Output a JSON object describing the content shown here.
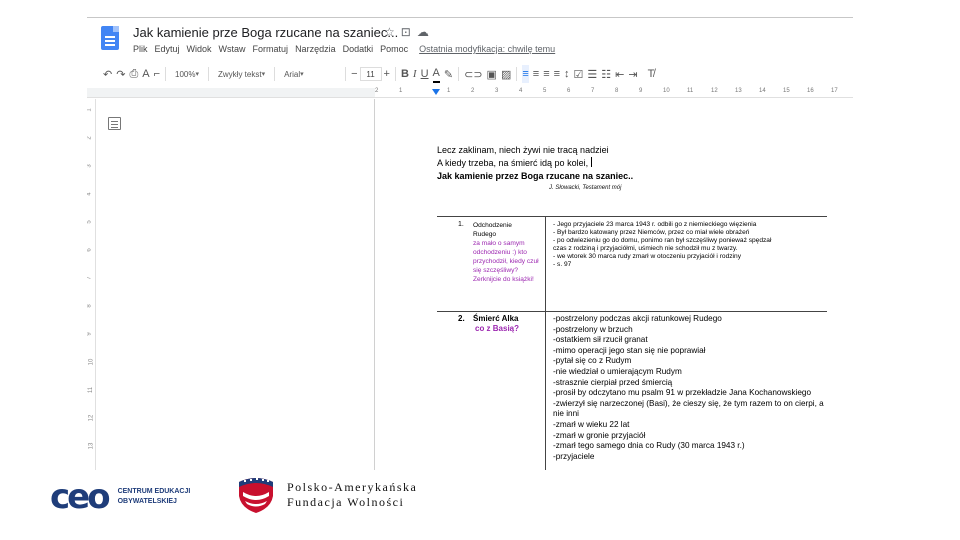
{
  "document": {
    "title": "Jak kamienie prze Boga rzucane na szaniec...",
    "menu": [
      "Plik",
      "Edytuj",
      "Widok",
      "Wstaw",
      "Formatuj",
      "Narzędzia",
      "Dodatki",
      "Pomoc"
    ],
    "last_edit": "Ostatnia modyfikacja: chwilę temu"
  },
  "toolbar": {
    "zoom": "100%",
    "style": "Zwykły tekst",
    "font": "Arial",
    "font_size": "11"
  },
  "ruler": {
    "numbers": [
      "2",
      "1",
      "",
      "1",
      "2",
      "3",
      "4",
      "5",
      "6",
      "7",
      "8",
      "9",
      "10",
      "11",
      "12",
      "13",
      "14",
      "15",
      "16",
      "17"
    ]
  },
  "vruler": {
    "numbers": [
      "1",
      "2",
      "3",
      "4",
      "5",
      "6",
      "7",
      "8",
      "9",
      "10",
      "11",
      "12",
      "13"
    ]
  },
  "page": {
    "poem_line1": "Lecz zaklinam, niech żywi nie tracą nadziei",
    "poem_line2": "A kiedy trzeba, na śmierć idą po kolei,",
    "poem_line3": "Jak kamienie przez Boga rzucane na szaniec..",
    "signature": "J. Słowacki, Testament mój",
    "row1": {
      "num": "1.",
      "label_line1": "Odchodzenie",
      "label_line2": "Rudego",
      "question": "za mało o samym odchodzeniu :) kto przychodził, kiedy czuł się szczęśliwy? Zerknijcie do książki!",
      "lines": [
        "- Jego przyjaciele 23 marca 1943  r. odbili go z niemieckiego więzienia",
        "- Był bardzo katowany przez Niemców, przez co miał wiele obrażeń",
        "- po odwiezieniu go do domu, ponimo ran był szczęśliwy ponieważ spędzał",
        "czas z rodziną i przyjaciółmi, uśmiech nie schodził mu z twarzy.",
        "- we wtorek 30 marca rudy zmarł w otoczeniu przyjaciół i rodziny",
        "- s. 97"
      ]
    },
    "row2": {
      "num": "2.",
      "label": "Śmierć Alka",
      "question": "co z Basią?",
      "lines": [
        "-postrzelony podczas akcji ratunkowej Rudego",
        "-postrzelony w brzuch",
        "-ostatkiem sił rzucił granat",
        "-mimo operacji jego stan się nie poprawiał",
        "-pytał się co z Rudym",
        "-nie wiedział o umierającym Rudym",
        "-strasznie cierpiał przed śmiercią",
        "-prosił by odczytano mu psalm 91 w przekładzie Jana Kochanowskiego",
        "-zwierzył się narzeczonej (Basi), że cieszy się, że tym razem to on cierpi, a nie inni",
        "-zmarł w wieku 22 lat",
        "-zmarł w gronie przyjaciół",
        "-zmarł tego samego dnia co Rudy (30 marca 1943 r.)",
        "-przyjaciele"
      ]
    }
  },
  "footer": {
    "ceo_mark": "ceo",
    "ceo_line1": "CENTRUM EDUKACJI",
    "ceo_line2": "OBYWATELSKIEJ",
    "pafw_line1": "Polsko-Amerykańska",
    "pafw_line2": "Fundacja Wolności"
  },
  "colors": {
    "accent": "#4285f4",
    "purple_comment": "#9c27b0",
    "ceo_blue": "#1f3d7a"
  }
}
